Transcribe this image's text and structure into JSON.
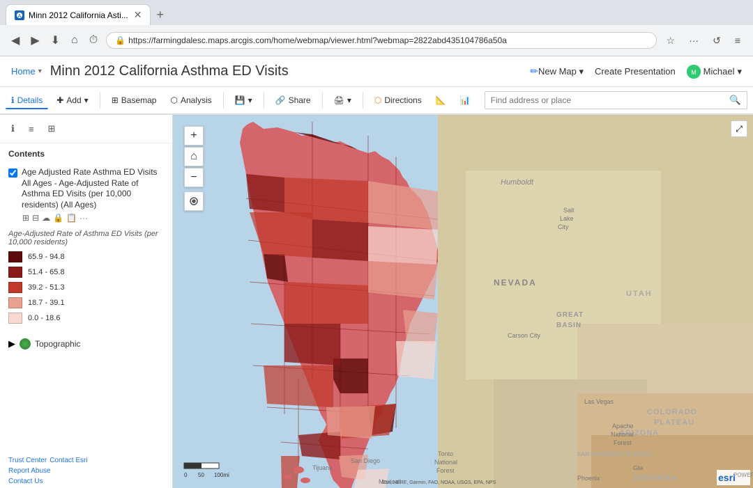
{
  "browser": {
    "tab_title": "Minn 2012 California Asti...",
    "tab_new_label": "+",
    "url": "https://farmingdalesc.maps.arcgis.com/home/webmap/viewer.html?webmap=2822abd435104786a50a",
    "nav": {
      "back": "◀",
      "forward": "▶",
      "download": "⬇",
      "home": "⌂",
      "history": "⏱",
      "menu_dots": "···",
      "refresh": "↺",
      "hamburger": "≡"
    },
    "actions": {
      "bookmark": "☆",
      "pin": "📌"
    }
  },
  "app": {
    "home_label": "Home",
    "title": "Minn 2012 California Asthma ED Visits",
    "edit_icon": "✏",
    "new_map_label": "New Map",
    "new_map_arrow": "▾",
    "create_presentation_label": "Create Presentation",
    "user_label": "Michael",
    "user_arrow": "▾",
    "user_initials": "M"
  },
  "toolbar": {
    "details_label": "Details",
    "add_label": "Add",
    "add_arrow": "▾",
    "basemap_label": "Basemap",
    "analysis_label": "Analysis",
    "save_arrow": "▾",
    "share_label": "Share",
    "print_arrow": "▾",
    "directions_label": "Directions",
    "measure_icon": "📏",
    "chart_icon": "📊",
    "search_placeholder": "Find address or place",
    "search_icon": "🔍"
  },
  "sidebar": {
    "tab_info": "ℹ",
    "tab_list": "≡",
    "tab_layers": "⊞",
    "contents_label": "Contents",
    "layer": {
      "name": "Age Adjusted Rate Asthma ED Visits All Ages - Age-Adjusted Rate of Asthma ED Visits (per 10,000 residents) (All Ages)",
      "tools": [
        "⊞",
        "⊟",
        "☁",
        "🔒",
        "📋",
        "···"
      ]
    },
    "legend_title": "Age-Adjusted Rate of Asthma ED Visits (per 10,000 residents)",
    "legend_items": [
      {
        "range": "65.9 - 94.8",
        "color": "#5C0A0A"
      },
      {
        "range": "51.4 - 65.8",
        "color": "#8B1A1A"
      },
      {
        "range": "39.2 - 51.3",
        "color": "#C0392B"
      },
      {
        "range": "18.7 - 39.1",
        "color": "#E8A090"
      },
      {
        "range": "0.0 - 18.6",
        "color": "#F9D8D0"
      }
    ],
    "topographic_label": "Topographic",
    "footer": {
      "trust_center": "Trust Center",
      "contact_esri": "Contact Esri",
      "report_abuse": "Report Abuse",
      "contact_us": "Contact Us"
    }
  },
  "map": {
    "zoom_in": "+",
    "zoom_out": "−",
    "home_btn": "⌂",
    "refresh_btn": "↺",
    "expand_btn": "⤢",
    "scale_labels": [
      "0",
      "50",
      "100mi"
    ],
    "attribution": "Esri, HERE, Garmin, FAO, NOAA, USGS, EPA, NPS",
    "map_labels": {
      "nevada": "NEVADA",
      "great_basin": "GREAT BASIN",
      "utah": "UTAH",
      "colorado_plateau": "COLORADO PLATEAU",
      "san_francisco_plateau": "SAN FRANCISCO PLATEAU",
      "arizona": "ARIZONA",
      "sonoran": "SONORAN",
      "humboldt": "Humboldt",
      "salt_lake": "Salt Lake City",
      "carson_city": "Carson City",
      "las_vegas": "Las Vegas",
      "phoenix": "Phoenix",
      "san_diego": "San Diego"
    }
  }
}
